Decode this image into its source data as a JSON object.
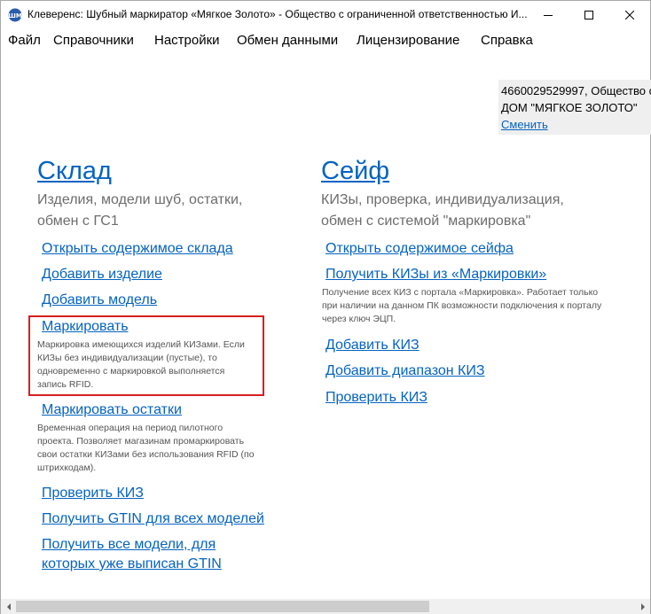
{
  "window": {
    "title": "Клеверенс: Шубный маркиратор «Мягкое Золото» - Общество с ограниченной ответственностью И..."
  },
  "menu": [
    "Файл",
    "Справочники",
    "Настройки",
    "Обмен данными",
    "Лицензирование",
    "Справка"
  ],
  "account": {
    "line1": "4660029529997, Общество с",
    "line2": "ДОМ \"МЯГКОЕ ЗОЛОТО\"",
    "change_label": "Сменить"
  },
  "warehouse": {
    "title": "Склад",
    "subtitle_line1": "Изделия, модели шуб, остатки,",
    "subtitle_line2": "обмен с ГС1",
    "links": {
      "open": "Открыть содержимое склада",
      "add_item": "Добавить изделие",
      "add_model": "Добавить модель",
      "mark": "Маркировать",
      "mark_note": "Маркировка имеющихся изделий КИЗами. Если КИЗы без индивидуализации (пустые), то одновременно с маркировкой выполняется запись RFID.",
      "mark_rest": "Маркировать остатки",
      "mark_rest_note": "Временная операция на период пилотного проекта. Позволяет магазинам промаркировать свои остатки КИЗами без использования RFID (по штрихкодам).",
      "check": "Проверить КИЗ",
      "get_gtin": "Получить GTIN для всех моделей",
      "get_models": "Получить все модели, для которых уже выписан GTIN"
    }
  },
  "safe": {
    "title": "Сейф",
    "subtitle_line1": "КИЗы, проверка, индивидуализация,",
    "subtitle_line2": "обмен с системой \"маркировка\"",
    "links": {
      "open": "Открыть содержимое сейфа",
      "get_kiz": "Получить КИЗы из «Маркировки»",
      "get_kiz_note": "Получение всех КИЗ с портала «Маркировка». Работает только при наличии на данном ПК возможности подключения к порталу через ключ ЭЦП.",
      "add_kiz": "Добавить КИЗ",
      "add_range": "Добавить диапазон КИЗ",
      "check": "Проверить КИЗ"
    }
  },
  "colors": {
    "link": "#0563c1",
    "highlight_border": "#d61f1f",
    "subtitle": "#6d6d6d"
  }
}
